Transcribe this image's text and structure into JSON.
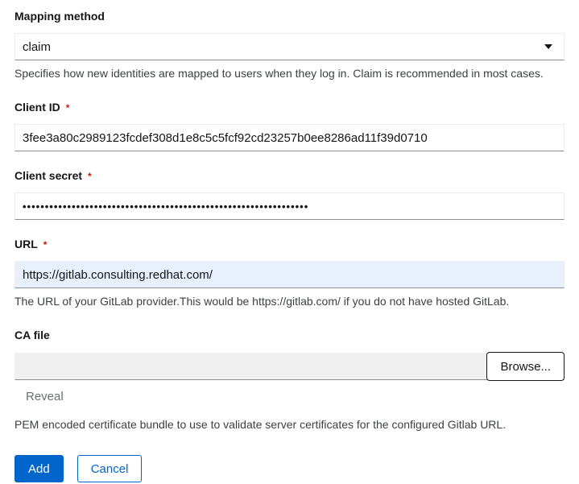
{
  "colors": {
    "primary": "#0066cc",
    "danger": "#c9190b",
    "autofill_background": "#e8f0fe",
    "input_bottom_border": "#8a8d90"
  },
  "form": {
    "mapping_method": {
      "label": "Mapping method",
      "selected_value": "claim",
      "help": "Specifies how new identities are mapped to users when they log in. Claim is recommended in most cases."
    },
    "client_id": {
      "label": "Client ID",
      "required_indicator": "*",
      "value": "3fee3a80c2989123fcdef308d1e8c5c5fcf92cd23257b0ee8286ad11f39d0710"
    },
    "client_secret": {
      "label": "Client secret",
      "required_indicator": "*",
      "masked_value": "••••••••••••••••••••••••••••••••••••••••••••••••••••••••••••••••"
    },
    "url": {
      "label": "URL",
      "required_indicator": "*",
      "value": "https://gitlab.consulting.redhat.com/",
      "help": "The URL of your GitLab provider.This would be https://gitlab.com/ if you do not have hosted GitLab."
    },
    "ca_file": {
      "label": "CA file",
      "value": "",
      "browse_label": "Browse...",
      "reveal_label": "Reveal",
      "help": "PEM encoded certificate bundle to use to validate server certificates for the configured Gitlab URL."
    }
  },
  "actions": {
    "add_label": "Add",
    "cancel_label": "Cancel"
  }
}
